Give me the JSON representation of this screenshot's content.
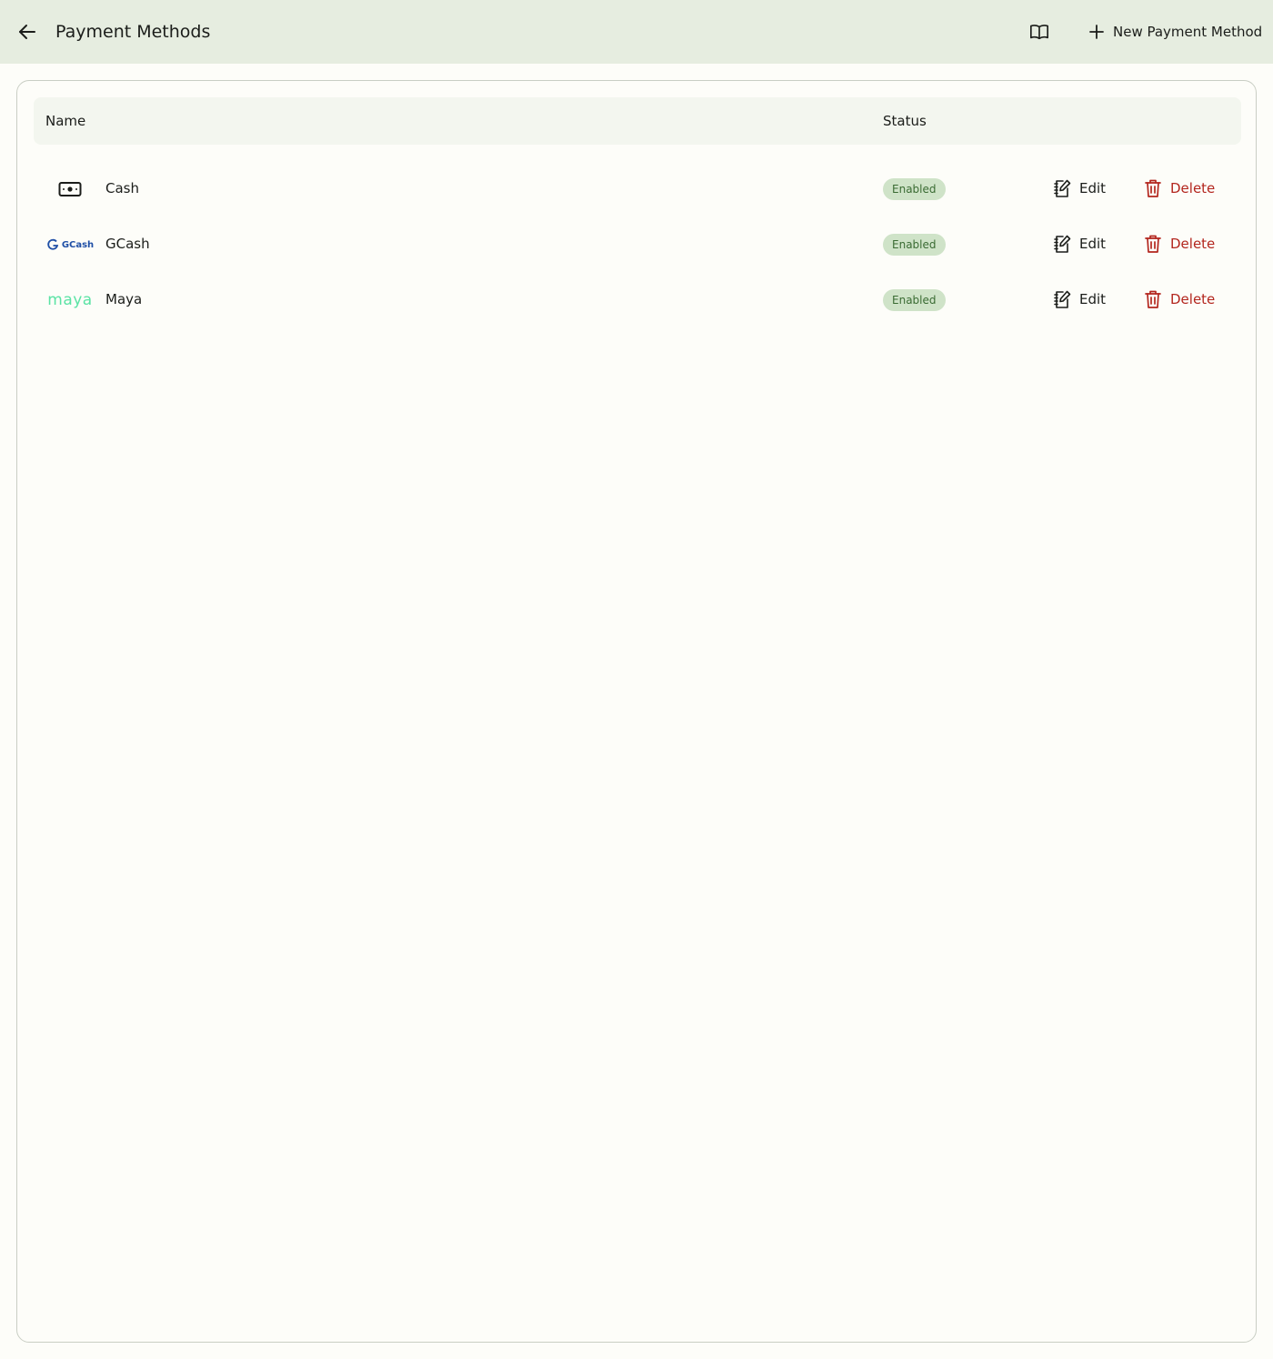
{
  "header": {
    "title": "Payment Methods",
    "back_icon": "arrow-left-icon",
    "docs_icon": "book-open-icon",
    "new_button_label": "New Payment Method",
    "new_button_icon": "plus-icon"
  },
  "table": {
    "columns": [
      "Name",
      "Status"
    ],
    "rows": [
      {
        "name": "Cash",
        "logo": "cash-icon",
        "logo_text": "",
        "status": "Enabled",
        "edit_label": "Edit",
        "delete_label": "Delete"
      },
      {
        "name": "GCash",
        "logo": "gcash-logo",
        "logo_text": "GCash",
        "status": "Enabled",
        "edit_label": "Edit",
        "delete_label": "Delete"
      },
      {
        "name": "Maya",
        "logo": "maya-logo",
        "logo_text": "maya",
        "status": "Enabled",
        "edit_label": "Edit",
        "delete_label": "Delete"
      }
    ]
  },
  "colors": {
    "header_bg": "#e6ede0",
    "badge_bg": "#cfe3c8",
    "badge_text": "#3a6b33",
    "delete": "#b3261e",
    "gcash_blue": "#1f4fa6",
    "maya_green": "#5be3a5"
  }
}
